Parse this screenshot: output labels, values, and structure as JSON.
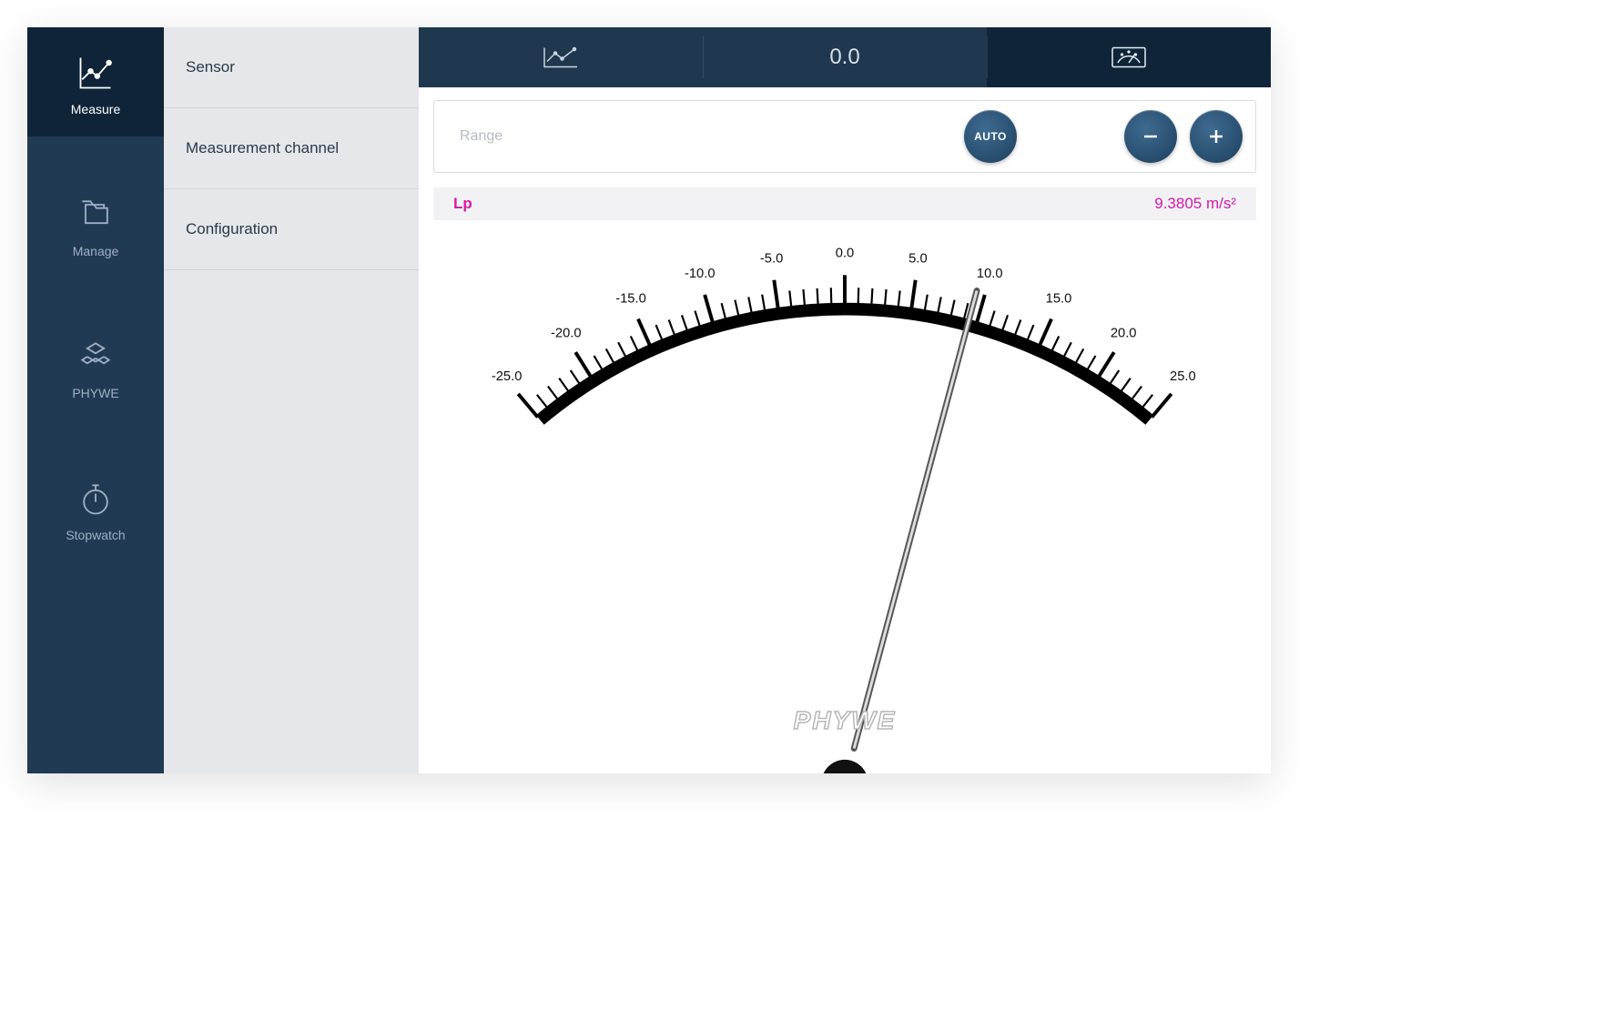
{
  "nav": {
    "items": [
      {
        "label": "Measure"
      },
      {
        "label": "Manage"
      },
      {
        "label": "PHYWE"
      },
      {
        "label": "Stopwatch"
      }
    ]
  },
  "sidebar": {
    "items": [
      {
        "label": "Sensor"
      },
      {
        "label": "Measurement channel"
      },
      {
        "label": "Configuration"
      }
    ]
  },
  "tabs": {
    "numeric_label": "0.0"
  },
  "rangebar": {
    "label": "Range",
    "auto_label": "AUTO"
  },
  "reading": {
    "channel": "Lp",
    "value": "9.3805 m/s²"
  },
  "gauge": {
    "min": -25.0,
    "max": 25.0,
    "needle_value": 9.3805,
    "major_ticks": [
      "-25.0",
      "-20.0",
      "-15.0",
      "-10.0",
      "-5.0",
      "0.0",
      "5.0",
      "10.0",
      "15.0",
      "20.0",
      "25.0"
    ],
    "brand": "PHYWE"
  },
  "colors": {
    "nav_bg": "#213a54",
    "nav_active": "#0f2438",
    "accent": "#2a5173",
    "magenta": "#d61aa8"
  }
}
